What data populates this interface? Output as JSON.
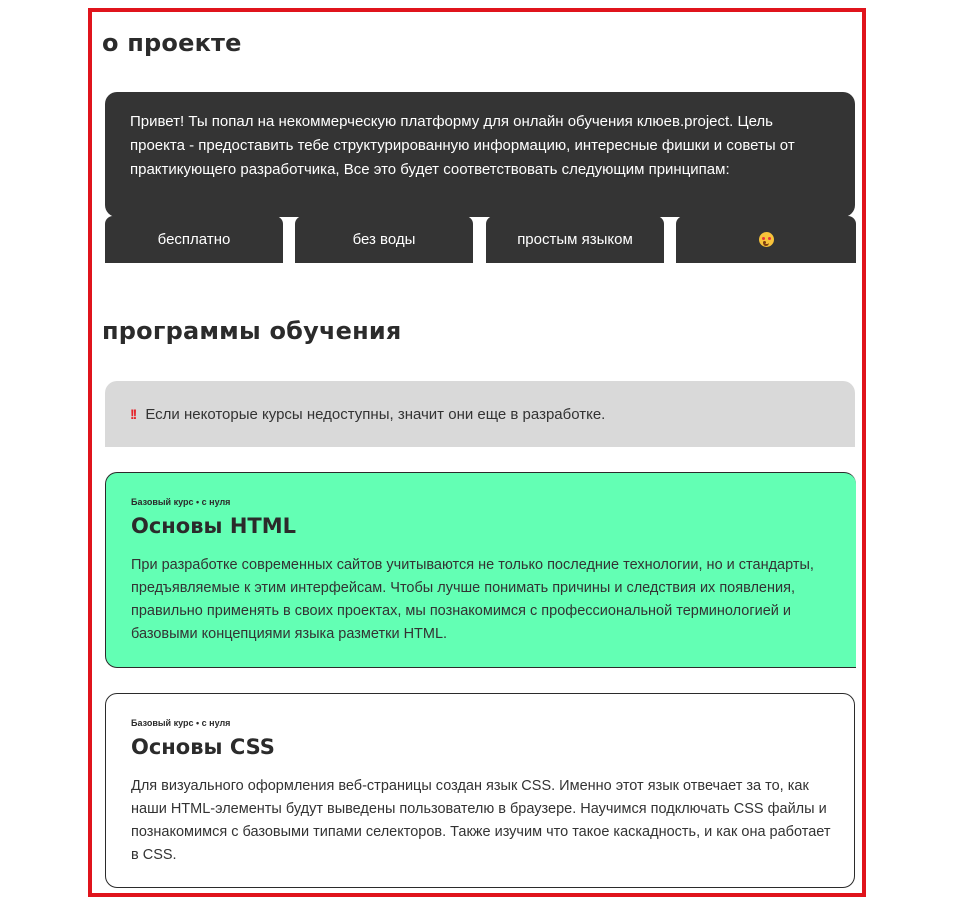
{
  "about": {
    "title": "о проекте",
    "intro": "Привет! Ты попал на некоммерческую платформу для онлайн обучения клюев.project. Цель проекта - предоставить тебе структурированную информацию, интересные фишки и советы от практикующего разработчика, Все это будет соответствовать следующим принципам:",
    "principles": [
      {
        "label": "бесплатно"
      },
      {
        "label": "без воды"
      },
      {
        "label": "простым языком"
      },
      {
        "label": "",
        "icon": "smiling-face-with-hearts-emoji"
      }
    ]
  },
  "programs": {
    "title": "программы обучения",
    "notice": {
      "icon": "double-exclamation-icon",
      "icon_glyph": "!!",
      "text": "Если некоторые курсы недоступны, значит они еще в разработке."
    },
    "courses": [
      {
        "tag": "Базовый курс • с нуля",
        "title": "Основы HTML",
        "description": "При разработке современных сайтов учитываются не только последние технологии, но и стандарты, предъявляемые к этим интерфейсам. Чтобы лучше понимать причины и следствия их появления, правильно применять в своих проектах, мы познакомимся с профессиональной терминологией и базовыми концепциями языка разметки HTML.",
        "color": "#63ffb4"
      },
      {
        "tag": "Базовый курс • с нуля",
        "title": "Основы CSS",
        "description": "Для визуального оформления веб-страницы создан язык CSS. Именно этот язык отвечает за то, как наши HTML-элементы будут выведены пользователю в браузере. Научимся подключать CSS файлы и познакомимся с базовыми типами селекторов. Также изучим что такое каскадность, и как она работает в CSS.",
        "color": "#ffffff"
      }
    ]
  },
  "colors": {
    "frame_border": "#e0141c",
    "dark_block": "#343434",
    "notice_bg": "#d9d9d9",
    "accent_green": "#63ffb4"
  }
}
